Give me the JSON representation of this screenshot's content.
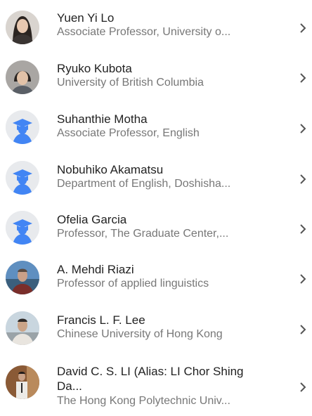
{
  "coauthors": [
    {
      "name": "Yuen Yi Lo",
      "affiliation": "Associate Professor, University o...",
      "avatar": "photo",
      "icon": "chevron-right-icon"
    },
    {
      "name": "Ryuko Kubota",
      "affiliation": "University of British Columbia",
      "avatar": "photo",
      "icon": "chevron-right-icon"
    },
    {
      "name": "Suhanthie Motha",
      "affiliation": "Associate Professor, English",
      "avatar": "graduation-cap-placeholder",
      "icon": "chevron-right-icon"
    },
    {
      "name": "Nobuhiko Akamatsu",
      "affiliation": "Department of English, Doshisha...",
      "avatar": "graduation-cap-placeholder",
      "icon": "chevron-right-icon"
    },
    {
      "name": "Ofelia Garcia",
      "affiliation": "Professor, The Graduate Center,...",
      "avatar": "graduation-cap-placeholder",
      "icon": "chevron-right-icon"
    },
    {
      "name": "A. Mehdi Riazi",
      "affiliation": "Professor of applied linguistics",
      "avatar": "photo",
      "icon": "chevron-right-icon"
    },
    {
      "name": "Francis L. F. Lee",
      "affiliation": "Chinese University of Hong Kong",
      "avatar": "photo",
      "icon": "chevron-right-icon"
    },
    {
      "name_line1": "David C. S. LI (Alias: LI Chor Shing",
      "name_line2": "Da...",
      "affiliation": "The Hong Kong Polytechnic Univ...",
      "avatar": "photo",
      "icon": "chevron-right-icon"
    }
  ],
  "colors": {
    "name_text": "#222222",
    "affiliation_text": "#777777",
    "chevron": "#555555",
    "placeholder_cap": "#4285f4",
    "placeholder_bg": "#e8eaed"
  }
}
